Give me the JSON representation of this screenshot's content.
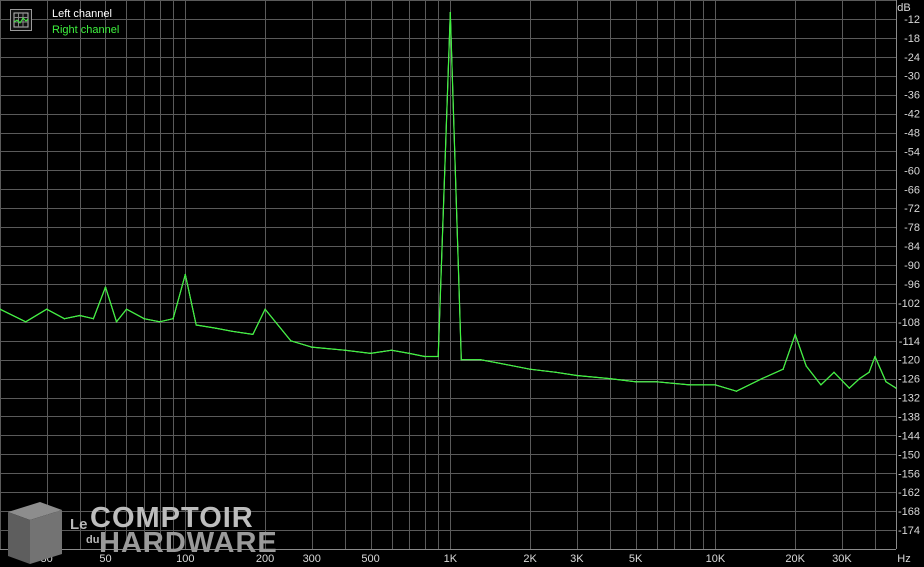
{
  "chart_data": {
    "type": "line",
    "title": "",
    "xlabel": "Hz",
    "ylabel": "dB",
    "x_scale": "log",
    "xlim": [
      20,
      48000
    ],
    "ylim": [
      -180,
      -6
    ],
    "grid": true,
    "legend_placement": "top-left",
    "x_tick_labels": [
      {
        "x": 30,
        "label": "30"
      },
      {
        "x": 50,
        "label": "50"
      },
      {
        "x": 100,
        "label": "100"
      },
      {
        "x": 200,
        "label": "200"
      },
      {
        "x": 300,
        "label": "300"
      },
      {
        "x": 500,
        "label": "500"
      },
      {
        "x": 1000,
        "label": "1K"
      },
      {
        "x": 2000,
        "label": "2K"
      },
      {
        "x": 3000,
        "label": "3K"
      },
      {
        "x": 5000,
        "label": "5K"
      },
      {
        "x": 10000,
        "label": "10K"
      },
      {
        "x": 20000,
        "label": "20K"
      },
      {
        "x": 30000,
        "label": "30K"
      }
    ],
    "y_ticks": [
      -12,
      -18,
      -24,
      -30,
      -36,
      -42,
      -48,
      -54,
      -60,
      -66,
      -72,
      -78,
      -84,
      -90,
      -96,
      -102,
      -108,
      -114,
      -120,
      -126,
      -132,
      -138,
      -144,
      -150,
      -156,
      -162,
      -168,
      -174
    ],
    "series": [
      {
        "name": "Left channel",
        "color": "#ffffff",
        "x": [
          20,
          25,
          30,
          35,
          40,
          45,
          50,
          55,
          60,
          70,
          80,
          90,
          100,
          110,
          130,
          150,
          180,
          200,
          250,
          300,
          400,
          500,
          600,
          700,
          800,
          900,
          1000,
          1100,
          1300,
          1500,
          2000,
          2500,
          3000,
          4000,
          5000,
          6000,
          8000,
          10000,
          12000,
          15000,
          18000,
          20000,
          22000,
          25000,
          28000,
          32000,
          35000,
          38000,
          40000,
          44000,
          48000
        ],
        "y": [
          -104,
          -108,
          -104,
          -107,
          -106,
          -107,
          -97,
          -108,
          -104,
          -107,
          -108,
          -107,
          -93,
          -109,
          -110,
          -111,
          -112,
          -104,
          -114,
          -116,
          -117,
          -118,
          -117,
          -118,
          -119,
          -119,
          -10,
          -120,
          -120,
          -121,
          -123,
          -124,
          -125,
          -126,
          -127,
          -127,
          -128,
          -128,
          -130,
          -126,
          -123,
          -112,
          -122,
          -128,
          -124,
          -129,
          -126,
          -124,
          -119,
          -127,
          -129
        ]
      },
      {
        "name": "Right channel",
        "color": "#3ef23e",
        "x": [
          20,
          25,
          30,
          35,
          40,
          45,
          50,
          55,
          60,
          70,
          80,
          90,
          100,
          110,
          130,
          150,
          180,
          200,
          250,
          300,
          400,
          500,
          600,
          700,
          800,
          900,
          1000,
          1100,
          1300,
          1500,
          2000,
          2500,
          3000,
          4000,
          5000,
          6000,
          8000,
          10000,
          12000,
          15000,
          18000,
          20000,
          22000,
          25000,
          28000,
          32000,
          35000,
          38000,
          40000,
          44000,
          48000
        ],
        "y": [
          -104,
          -108,
          -104,
          -107,
          -106,
          -107,
          -97,
          -108,
          -104,
          -107,
          -108,
          -107,
          -93,
          -109,
          -110,
          -111,
          -112,
          -104,
          -114,
          -116,
          -117,
          -118,
          -117,
          -118,
          -119,
          -119,
          -10,
          -120,
          -120,
          -121,
          -123,
          -124,
          -125,
          -126,
          -127,
          -127,
          -128,
          -128,
          -130,
          -126,
          -123,
          -112,
          -122,
          -128,
          -124,
          -129,
          -126,
          -124,
          -119,
          -127,
          -129
        ]
      }
    ]
  },
  "legend": {
    "left_label": "Left channel",
    "right_label": "Right channel"
  },
  "watermark": {
    "le": "Le",
    "du": "du",
    "comptoir": "COMPTOIR",
    "hardware": "HARDWARE"
  }
}
